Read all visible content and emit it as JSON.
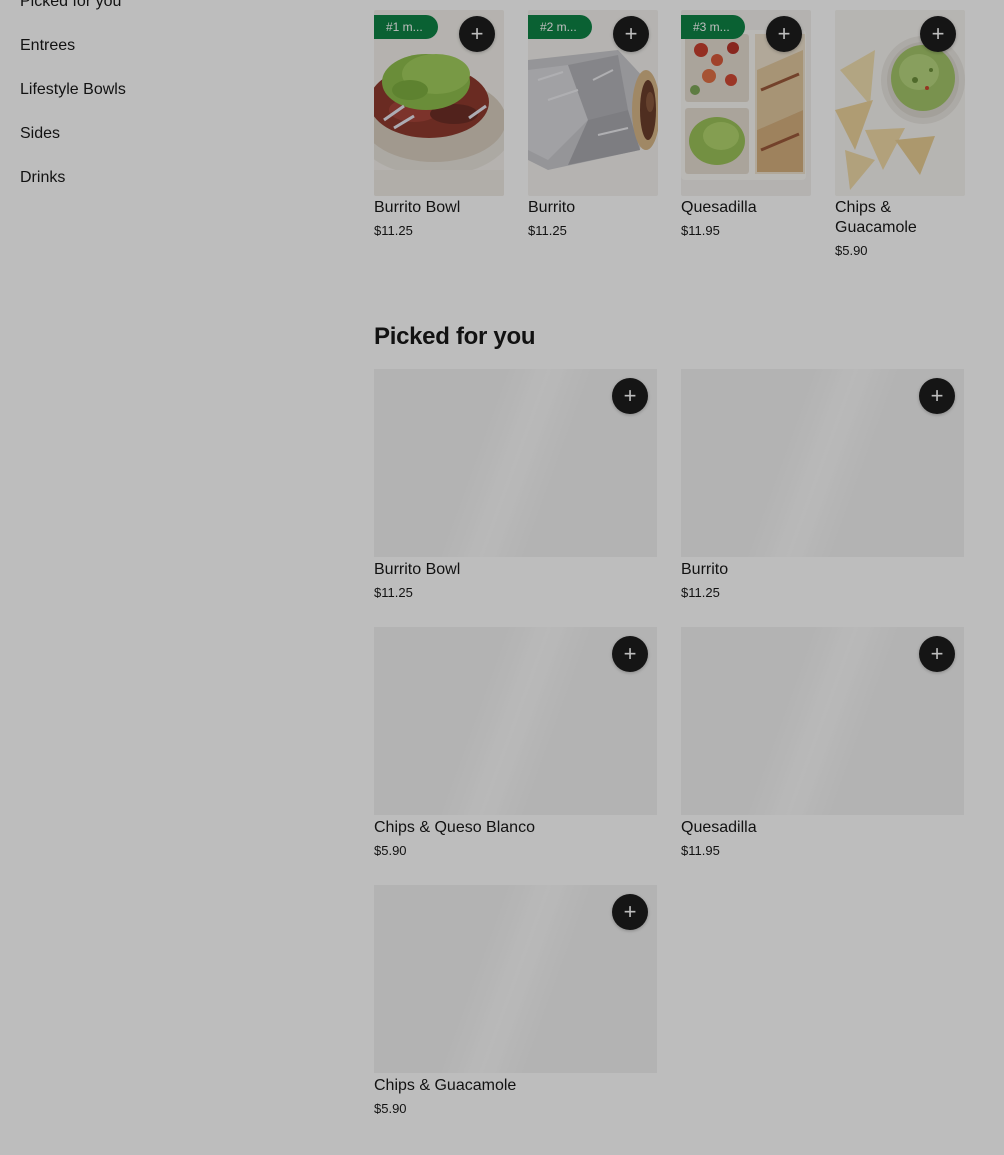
{
  "sidebar": {
    "items": [
      {
        "label": "Picked for you"
      },
      {
        "label": "Entrees"
      },
      {
        "label": "Lifestyle Bowls"
      },
      {
        "label": "Sides"
      },
      {
        "label": "Drinks"
      }
    ]
  },
  "popular": {
    "items": [
      {
        "badge": "#1 m...",
        "name": "Burrito Bowl",
        "price": "$11.25",
        "add_icon": "plus-icon"
      },
      {
        "badge": "#2 m...",
        "name": "Burrito",
        "price": "$11.25",
        "add_icon": "plus-icon"
      },
      {
        "badge": "#3 m...",
        "name": "Quesadilla",
        "price": "$11.95",
        "add_icon": "plus-icon"
      },
      {
        "name": "Chips & Guacamole",
        "price": "$5.90",
        "add_icon": "plus-icon"
      }
    ]
  },
  "picked": {
    "title": "Picked for you",
    "items": [
      {
        "name": "Burrito Bowl",
        "price": "$11.25"
      },
      {
        "name": "Burrito",
        "price": "$11.25"
      },
      {
        "name": "Chips & Queso Blanco",
        "price": "$5.90"
      },
      {
        "name": "Quesadilla",
        "price": "$11.95"
      },
      {
        "name": "Chips & Guacamole",
        "price": "$5.90"
      }
    ]
  },
  "colors": {
    "badge_green": "#0e8345",
    "add_button": "#1d1d1d",
    "placeholder_gray": "#f2f2f2",
    "text": "#191919"
  },
  "icons": {
    "add": "+"
  }
}
